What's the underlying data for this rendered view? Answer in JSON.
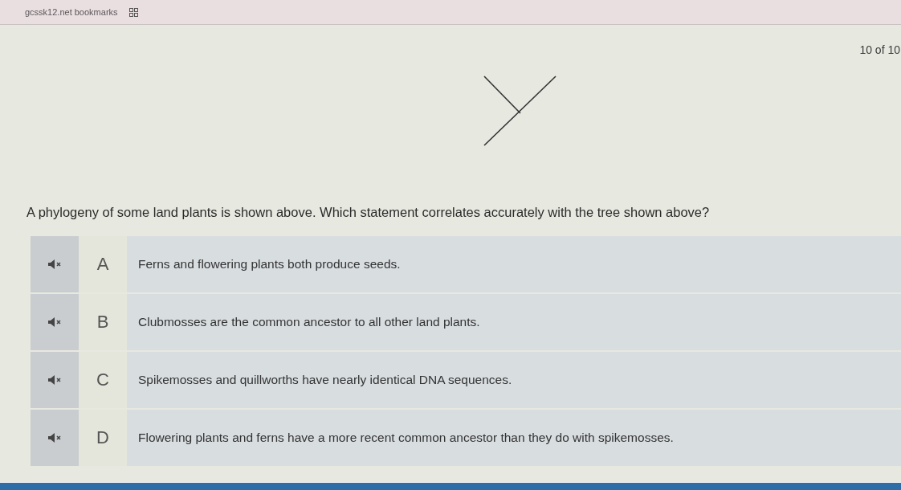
{
  "bookmarks_bar": {
    "items": [
      {
        "label": "gcssk12.net bookmarks"
      }
    ]
  },
  "question": {
    "counter": "10 of 10",
    "prompt": "A phylogeny of some land plants is shown above. Which statement correlates accurately with the tree shown above?",
    "options": [
      {
        "letter": "A",
        "text": "Ferns and flowering plants both produce seeds."
      },
      {
        "letter": "B",
        "text": "Clubmosses are the common ancestor to all other land plants."
      },
      {
        "letter": "C",
        "text": "Spikemosses and quillworths have nearly identical DNA sequences."
      },
      {
        "letter": "D",
        "text": "Flowering plants and ferns have a more recent common ancestor than they do with spikemosses."
      }
    ]
  }
}
